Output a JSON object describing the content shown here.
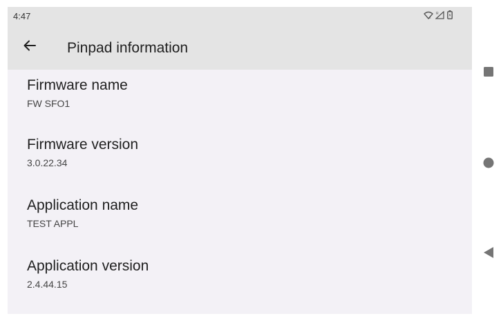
{
  "status_bar": {
    "time": "4:47",
    "icons": [
      "wifi-icon",
      "signal-icon",
      "battery-icon"
    ]
  },
  "app_bar": {
    "back_icon": "arrow-back-icon",
    "title": "Pinpad information"
  },
  "items": [
    {
      "title": "Firmware name",
      "summary": "FW SFO1"
    },
    {
      "title": "Firmware version",
      "summary": "3.0.22.34"
    },
    {
      "title": "Application name",
      "summary": "TEST APPL"
    },
    {
      "title": "Application version",
      "summary": "2.4.44.15"
    }
  ],
  "nav_bar": {
    "buttons": [
      "recents-square-icon",
      "home-circle-icon",
      "back-triangle-icon"
    ]
  },
  "colors": {
    "app_bar_bg": "#e4e4e4",
    "content_bg": "#f3f1f6",
    "text_primary": "#1f1f1f",
    "text_secondary": "#444444",
    "nav_icon": "#757575"
  }
}
